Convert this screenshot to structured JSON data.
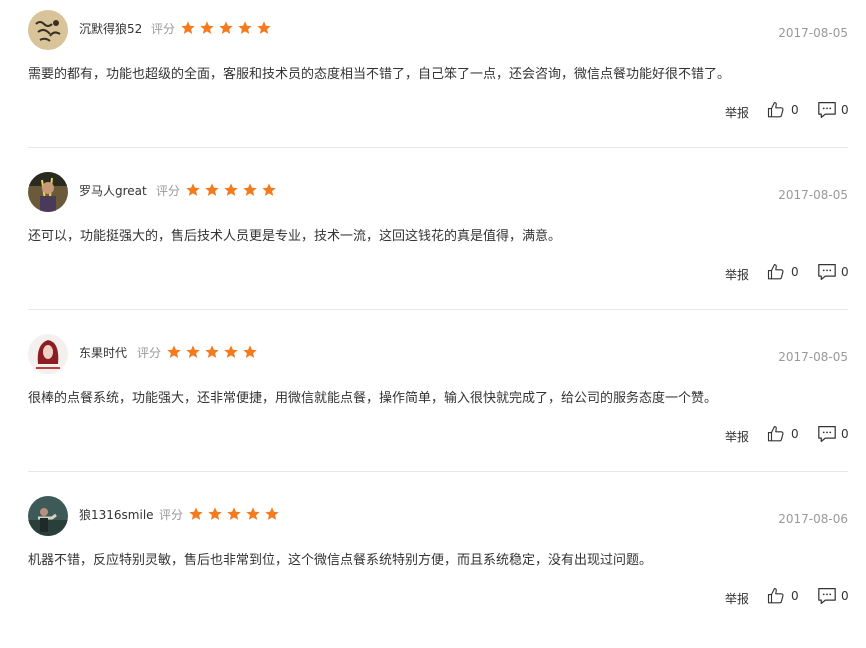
{
  "rating_label": "评分",
  "actions": {
    "report_label": "举报"
  },
  "colors": {
    "star": "#f37b1d",
    "text": "#333333",
    "muted": "#999999"
  },
  "reviews": [
    {
      "username": "沉默得狼52",
      "stars": 5,
      "date": "2017-08-05",
      "content": "需要的都有，功能也超级的全面，客服和技术员的态度相当不错了，自己笨了一点，还会咨询，微信点餐功能好很不错了。",
      "likes": "0",
      "comments": "0",
      "avatar_icon": "calligraphy-avatar-icon"
    },
    {
      "username": "罗马人great",
      "stars": 5,
      "date": "2017-08-05",
      "content": "还可以，功能挺强大的，售后技术人员更是专业，技术一流，这回这钱花的真是值得，满意。",
      "likes": "0",
      "comments": "0",
      "avatar_icon": "photo-avatar-icon"
    },
    {
      "username": "东果时代",
      "stars": 5,
      "date": "2017-08-05",
      "content": "很棒的点餐系统，功能强大，还非常便捷，用微信就能点餐，操作简单，输入很快就完成了，给公司的服务态度一个赞。",
      "likes": "0",
      "comments": "0",
      "avatar_icon": "portrait-avatar-icon"
    },
    {
      "username": "狼1316smile",
      "stars": 5,
      "date": "2017-08-06",
      "content": "机器不错，反应特别灵敏，售后也非常到位，这个微信点餐系统特别方便，而且系统稳定，没有出现过问题。",
      "likes": "0",
      "comments": "0",
      "avatar_icon": "outdoor-avatar-icon"
    }
  ]
}
